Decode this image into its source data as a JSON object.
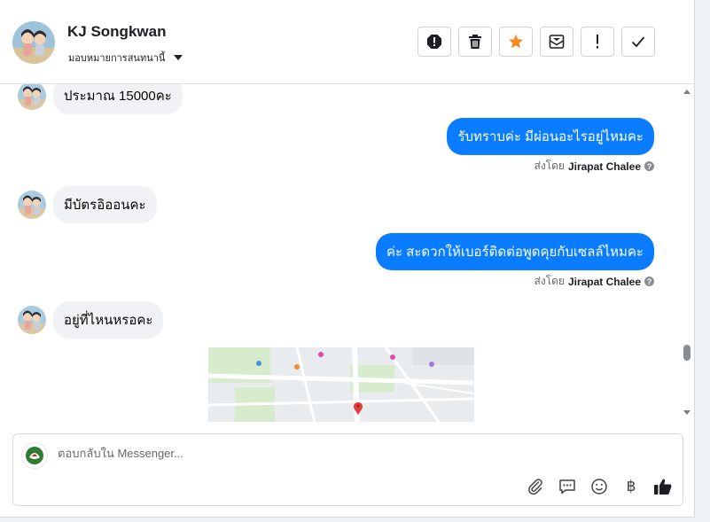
{
  "contact": {
    "name": "KJ Songkwan",
    "assign_label": "มอบหมายการสนทนานี้"
  },
  "actions": [
    {
      "name": "spam-icon"
    },
    {
      "name": "trash-icon"
    },
    {
      "name": "star-icon",
      "color": "#f28b24"
    },
    {
      "name": "mark-unread-icon"
    },
    {
      "name": "follow-up-icon"
    },
    {
      "name": "done-check-icon"
    }
  ],
  "messages": {
    "m1": {
      "text": "ประมาณ 15000คะ"
    },
    "m2": {
      "text": "รับทราบค่ะ มีผ่อนอะไรอยู่ไหมคะ",
      "sent_by_prefix": "ส่งโดย",
      "sent_by_name": "Jirapat Chalee"
    },
    "m3": {
      "text": "มีบัตรอิออนคะ"
    },
    "m4": {
      "text": "ค่ะ สะดวกให้เบอร์ติดต่อพูดคุยกับเซลล์ไหมคะ",
      "sent_by_prefix": "ส่งโดย",
      "sent_by_name": "Jirapat Chalee"
    },
    "m5": {
      "text": "อยู่ที่ไหนหรอคะ"
    }
  },
  "composer": {
    "placeholder": "ตอบกลับใน Messenger..."
  },
  "tools": {
    "currency_symbol": "฿"
  },
  "colors": {
    "outgoing_bubble": "#0a7cff",
    "incoming_bubble": "#f0f2f5",
    "star": "#f28b24"
  }
}
